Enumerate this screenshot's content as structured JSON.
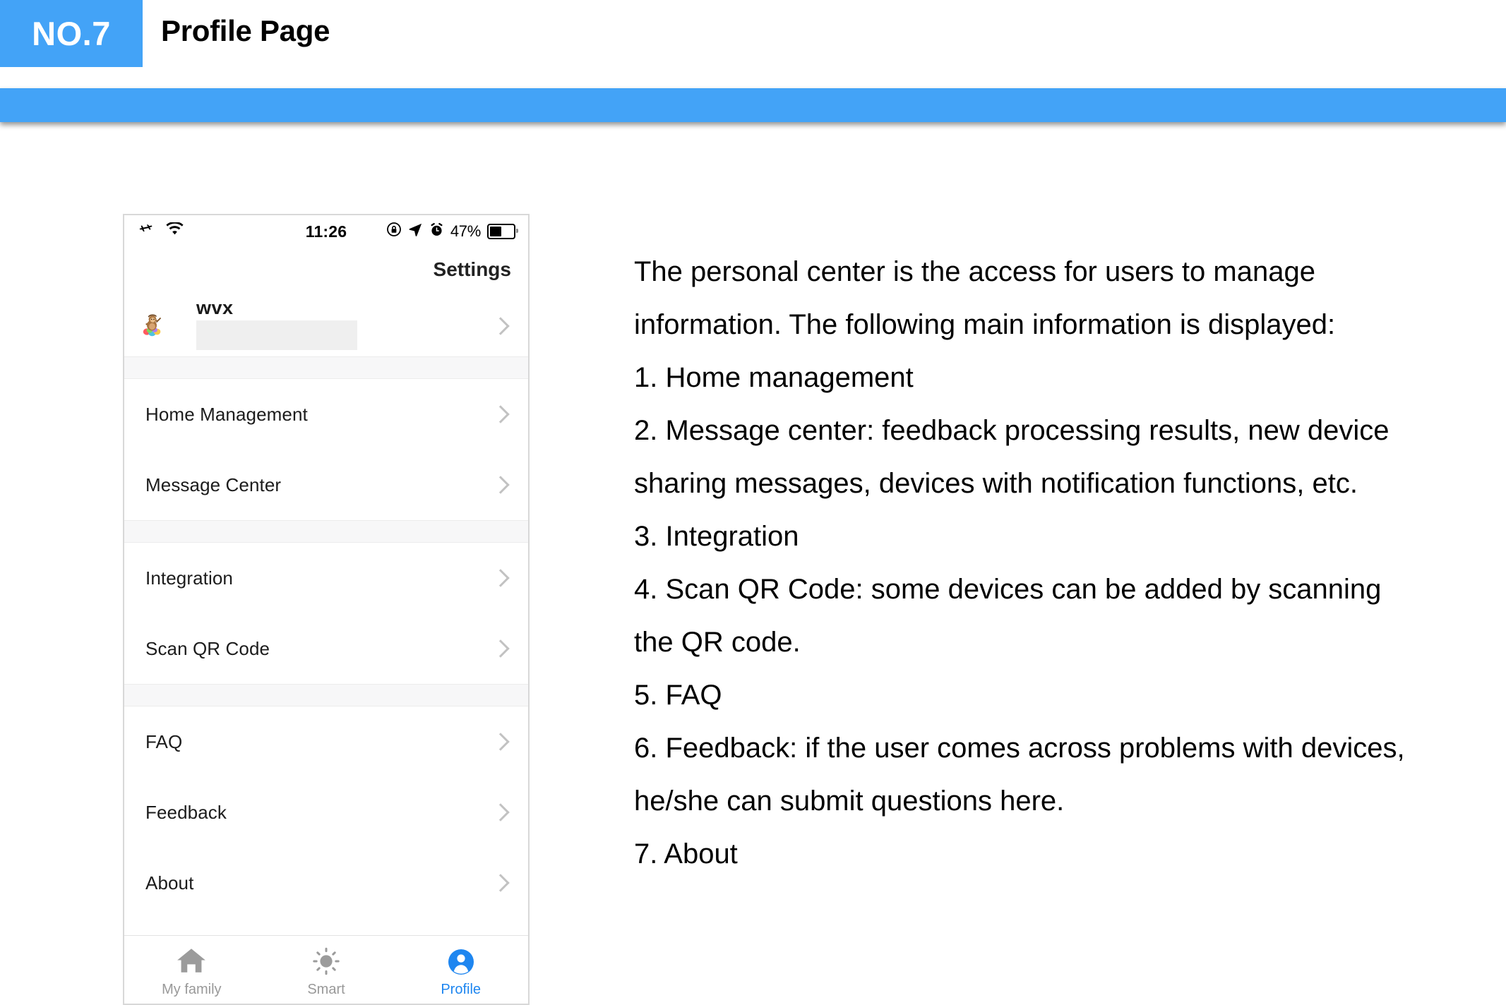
{
  "slide": {
    "badge": "NO.7",
    "title": "Profile Page",
    "accent_color": "#43A3F7"
  },
  "phone": {
    "statusbar": {
      "airplane_icon": "airplane-mode-icon",
      "wifi_icon": "wifi-icon",
      "time": "11:26",
      "rotation_lock_icon": "rotation-lock-icon",
      "location_icon": "location-arrow-icon",
      "alarm_icon": "alarm-clock-icon",
      "battery_percent": "47%",
      "battery_icon": "battery-icon"
    },
    "settings_label": "Settings",
    "profile": {
      "avatar": "user-avatar-icon",
      "name": "wvx",
      "redacted_value": "",
      "chevron": "chevron-right-icon"
    },
    "menu_groups": [
      {
        "items": [
          {
            "label": "Home Management",
            "chevron": "chevron-right-icon"
          },
          {
            "label": "Message Center",
            "chevron": "chevron-right-icon"
          }
        ]
      },
      {
        "items": [
          {
            "label": "Integration",
            "chevron": "chevron-right-icon"
          },
          {
            "label": "Scan QR Code",
            "chevron": "chevron-right-icon"
          }
        ]
      },
      {
        "items": [
          {
            "label": "FAQ",
            "chevron": "chevron-right-icon"
          },
          {
            "label": "Feedback",
            "chevron": "chevron-right-icon"
          },
          {
            "label": "About",
            "chevron": "chevron-right-icon"
          }
        ]
      }
    ],
    "tabs": [
      {
        "label": "My family",
        "icon": "home-icon",
        "active": false
      },
      {
        "label": "Smart",
        "icon": "sun-icon",
        "active": false
      },
      {
        "label": "Profile",
        "icon": "person-icon",
        "active": true
      }
    ],
    "active_tab_color": "#1E86F0"
  },
  "description": {
    "lines": [
      "The personal center is the access for users to manage information. The following main information is displayed:",
      "1. Home management",
      "2. Message center: feedback processing results, new device sharing messages, devices with notification functions, etc.",
      "3. Integration",
      "4. Scan QR Code: some devices can be added by scanning the QR code.",
      "5. FAQ",
      "6. Feedback: if the user comes across problems with devices, he/she can submit questions here.",
      "7. About"
    ]
  }
}
